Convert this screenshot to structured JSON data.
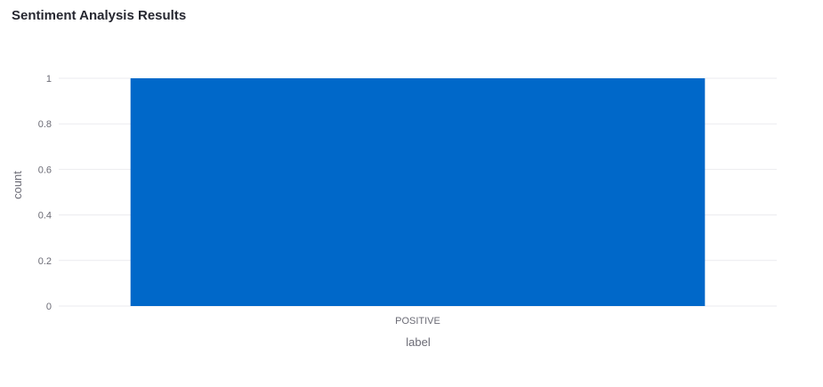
{
  "chart_data": {
    "type": "bar",
    "title": "Sentiment Analysis Results",
    "xlabel": "label",
    "ylabel": "count",
    "categories": [
      "POSITIVE"
    ],
    "values": [
      1
    ],
    "ylim": [
      0,
      1
    ],
    "yticks": [
      "0",
      "0.2",
      "0.4",
      "0.6",
      "0.8",
      "1"
    ],
    "grid": true,
    "legend": "none",
    "bar_color": "#0068c9"
  }
}
